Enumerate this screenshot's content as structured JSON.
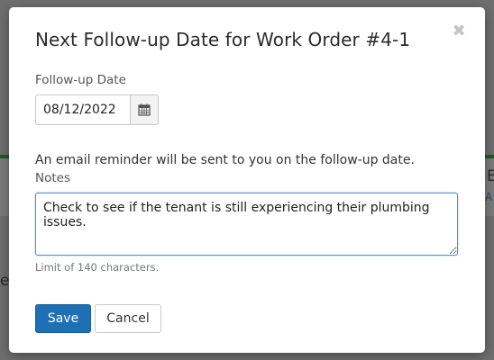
{
  "dialog": {
    "title": "Next Follow-up Date for Work Order #4-1",
    "close_icon": "close-icon",
    "followup_label": "Follow-up Date",
    "followup_value": "08/12/2022",
    "calendar_icon": "calendar-icon",
    "reminder_text": "An email reminder will be sent to you on the follow-up date.",
    "notes_label": "Notes",
    "notes_value": "Check to see if the tenant is still experiencing their plumbing issues.",
    "notes_hint": "Limit of 140 characters.",
    "save_label": "Save",
    "cancel_label": "Cancel"
  },
  "background": {
    "fragment_right_top": "E",
    "fragment_right_mid": "A",
    "fragment_left": "e"
  },
  "colors": {
    "primary": "#1f6fb5",
    "focus_border": "#4f8ed6",
    "overlay": "#6e6e6e"
  }
}
